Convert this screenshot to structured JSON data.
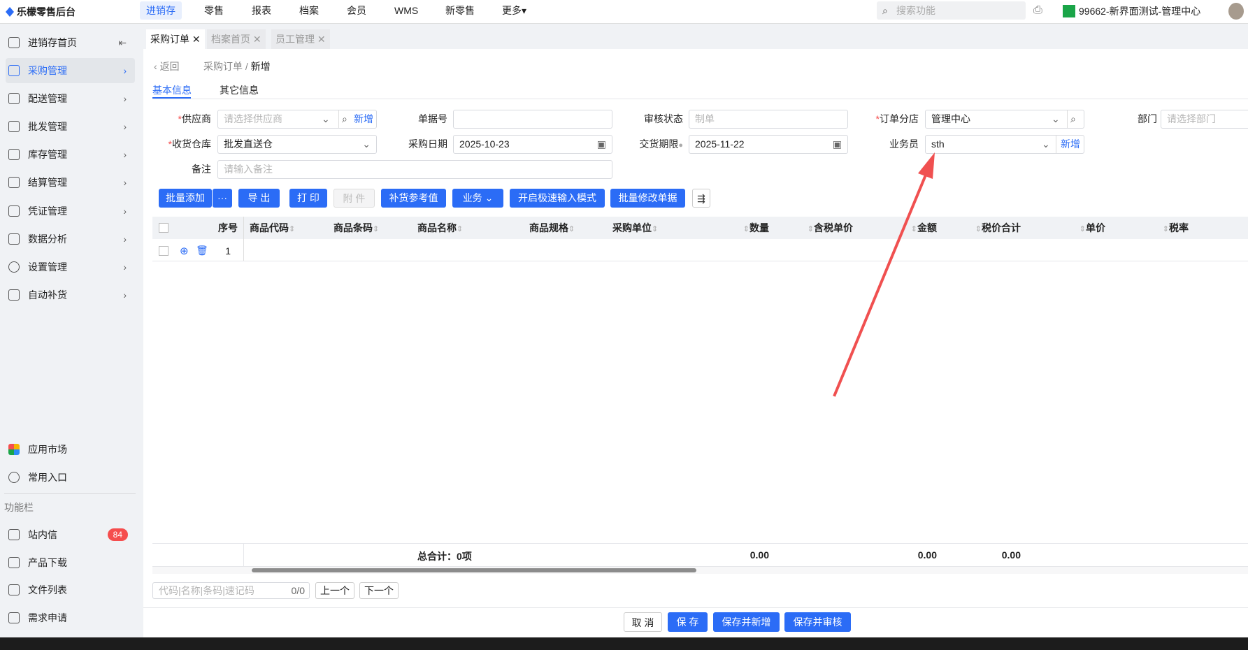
{
  "app": {
    "title": "乐檬零售后台"
  },
  "topnav": {
    "items": [
      "进销存",
      "零售",
      "报表",
      "档案",
      "会员",
      "WMS",
      "新零售",
      "更多▾"
    ],
    "search_placeholder": "搜索功能",
    "store": "99662-新界面测试-管理中心"
  },
  "sidebar": {
    "items": [
      "进销存首页",
      "采购管理",
      "配送管理",
      "批发管理",
      "库存管理",
      "结算管理",
      "凭证管理",
      "数据分析",
      "设置管理",
      "自动补货"
    ],
    "extra": [
      "应用市场",
      "常用入口"
    ],
    "section": "功能栏",
    "tools": [
      "站内信",
      "产品下载",
      "文件列表",
      "需求申请"
    ],
    "badge": "84"
  },
  "tabs": [
    "采购订单",
    "档案首页",
    "员工管理"
  ],
  "breadcrumb": {
    "back": "返回",
    "parent": "采购订单",
    "current": "新增"
  },
  "subtabs": [
    "基本信息",
    "其它信息"
  ],
  "form": {
    "supplier": {
      "label": "供应商",
      "placeholder": "请选择供应商",
      "add": "新增"
    },
    "doc_no": {
      "label": "单据号",
      "value": ""
    },
    "audit": {
      "label": "审核状态",
      "placeholder": "制单"
    },
    "branch": {
      "label": "订单分店",
      "value": "管理中心"
    },
    "dept": {
      "label": "部门",
      "placeholder": "请选择部门"
    },
    "warehouse": {
      "label": "收货仓库",
      "value": "批发直送仓"
    },
    "date": {
      "label": "采购日期",
      "value": "2025-10-23"
    },
    "deadline": {
      "label": "交货期限",
      "value": "2025-11-22"
    },
    "salesman": {
      "label": "业务员",
      "value": "sth",
      "add": "新增"
    },
    "remark": {
      "label": "备注",
      "placeholder": "请输入备注"
    }
  },
  "toolbar": [
    "批量添加",
    "···",
    "导 出",
    "打 印",
    "附 件",
    "补货参考值",
    "业务 ⌄",
    "开启极速输入模式",
    "批量修改单据"
  ],
  "table": {
    "columns": [
      "序号",
      "商品代码",
      "商品条码",
      "商品名称",
      "商品规格",
      "采购单位",
      "数量",
      "含税单价",
      "金额",
      "税价合计",
      "单价",
      "税率"
    ],
    "rows": [
      {
        "index": "1"
      }
    ]
  },
  "footer": {
    "total": "总合计：0项",
    "qty": "0.00",
    "amount": "0.00",
    "tax_total": "0.00"
  },
  "finder": {
    "placeholder": "代码|名称|条码|速记码",
    "count": "0/0",
    "prev": "上一个",
    "next": "下一个"
  },
  "actions": [
    "取 消",
    "保 存",
    "保存并新增",
    "保存并审核"
  ]
}
